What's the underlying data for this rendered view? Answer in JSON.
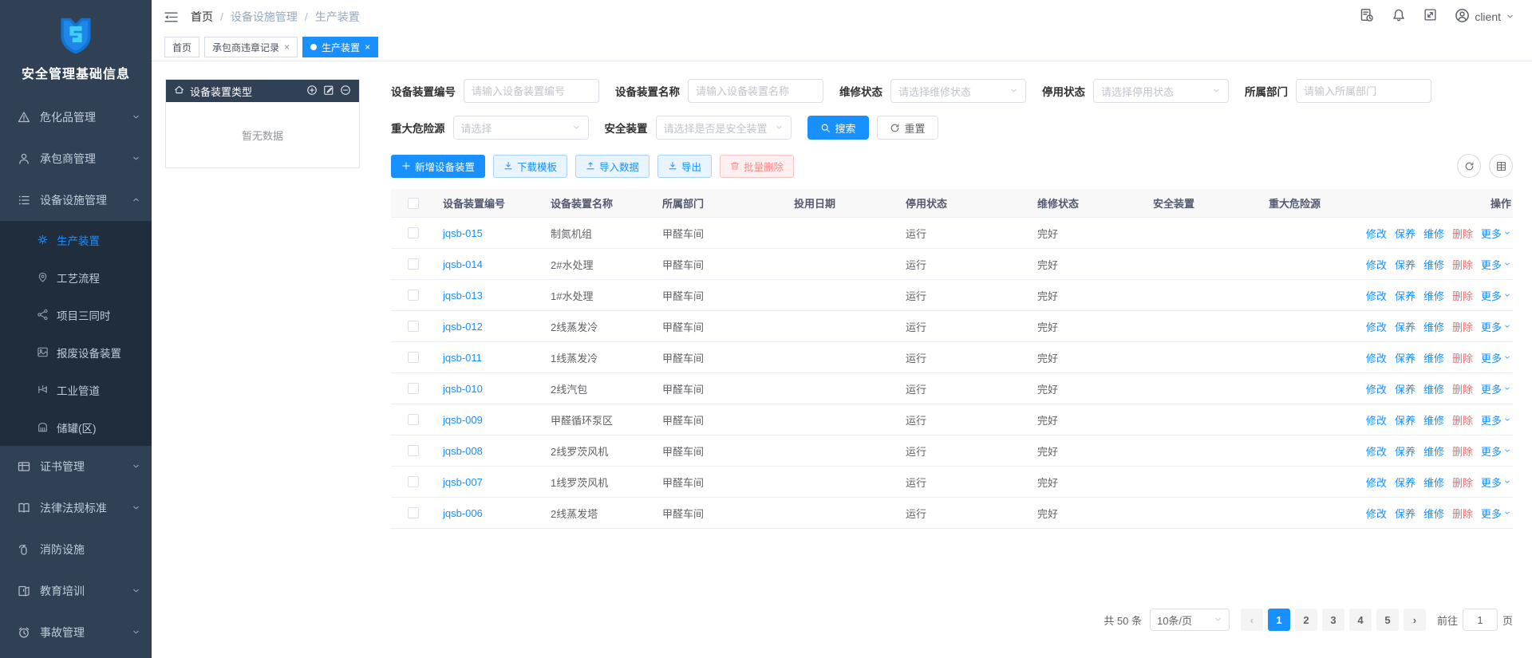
{
  "colors": {
    "accent": "#1890ff",
    "link": "#1890ff",
    "danger": "#f56c6c",
    "sidebar_bg": "#304156",
    "submenu_bg": "#1f2d3d"
  },
  "sidebar": {
    "title": "安全管理基础信息",
    "menu": [
      {
        "key": "hazmat",
        "icon": "hazard",
        "label": "危化品管理",
        "chevron": "down"
      },
      {
        "key": "contractor",
        "icon": "contractor",
        "label": "承包商管理",
        "chevron": "down"
      },
      {
        "key": "equipment",
        "icon": "equipment",
        "label": "设备设施管理",
        "chevron": "up",
        "children": [
          {
            "key": "production",
            "icon": "production",
            "label": "生产装置",
            "active": true
          },
          {
            "key": "process",
            "icon": "process",
            "label": "工艺流程"
          },
          {
            "key": "three-simultaneous",
            "icon": "three",
            "label": "项目三同时"
          },
          {
            "key": "scrap",
            "icon": "scrap",
            "label": "报废设备装置"
          },
          {
            "key": "pipeline",
            "icon": "pipeline",
            "label": "工业管道"
          },
          {
            "key": "tank",
            "icon": "tank",
            "label": "储罐(区)"
          }
        ]
      },
      {
        "key": "certificate",
        "icon": "cert",
        "label": "证书管理",
        "chevron": "down"
      },
      {
        "key": "law",
        "icon": "law",
        "label": "法律法规标准",
        "chevron": "down"
      },
      {
        "key": "fire",
        "icon": "fire",
        "label": "消防设施"
      },
      {
        "key": "education",
        "icon": "education",
        "label": "教育培训",
        "chevron": "down"
      },
      {
        "key": "accident",
        "icon": "accident",
        "label": "事故管理",
        "chevron": "down"
      }
    ]
  },
  "navbar": {
    "breadcrumb": [
      "首页",
      "设备设施管理",
      "生产装置"
    ],
    "user": "client"
  },
  "tabs": [
    {
      "label": "首页",
      "closable": false,
      "active": false
    },
    {
      "label": "承包商违章记录",
      "closable": true,
      "active": false
    },
    {
      "label": "生产装置",
      "closable": true,
      "active": true
    }
  ],
  "tree_panel": {
    "title": "设备装置类型",
    "empty_text": "暂无数据"
  },
  "filters": {
    "rows": [
      [
        {
          "key": "eq-code",
          "label": "设备装置编号",
          "type": "input",
          "placeholder": "请输入设备装置编号"
        },
        {
          "key": "eq-name",
          "label": "设备装置名称",
          "type": "input",
          "placeholder": "请输入设备装置名称"
        },
        {
          "key": "repair-status",
          "label": "维修状态",
          "type": "select",
          "placeholder": "请选择维修状态"
        },
        {
          "key": "stop-status",
          "label": "停用状态",
          "type": "select",
          "placeholder": "请选择停用状态"
        },
        {
          "key": "dept",
          "label": "所属部门",
          "type": "input",
          "placeholder": "请输入所属部门"
        }
      ],
      [
        {
          "key": "hazard",
          "label": "重大危险源",
          "type": "select",
          "placeholder": "请选择"
        },
        {
          "key": "safety",
          "label": "安全装置",
          "type": "select",
          "placeholder": "请选择是否是安全装置"
        }
      ]
    ],
    "search_label": "搜索",
    "reset_label": "重置"
  },
  "toolbar": {
    "buttons": [
      {
        "key": "add",
        "label": "新增设备装置",
        "icon": "plus",
        "style": "primary"
      },
      {
        "key": "download-template",
        "label": "下载模板",
        "icon": "download",
        "style": "primary-plain"
      },
      {
        "key": "import-data",
        "label": "导入数据",
        "icon": "upload",
        "style": "primary-plain"
      },
      {
        "key": "export",
        "label": "导出",
        "icon": "download",
        "style": "primary-plain"
      },
      {
        "key": "batch-delete",
        "label": "批量删除",
        "icon": "trash",
        "style": "danger-plain"
      }
    ]
  },
  "table": {
    "columns": [
      "设备装置编号",
      "设备装置名称",
      "所属部门",
      "投用日期",
      "停用状态",
      "维修状态",
      "安全装置",
      "重大危险源",
      "操作"
    ],
    "rows": [
      {
        "code": "jqsb-015",
        "name": "制氮机组",
        "dept": "甲醛车间",
        "date": "",
        "stop_status": "运行",
        "repair_status": "完好",
        "safety": "",
        "hazard": ""
      },
      {
        "code": "jqsb-014",
        "name": "2#水处理",
        "dept": "甲醛车间",
        "date": "",
        "stop_status": "运行",
        "repair_status": "完好",
        "safety": "",
        "hazard": ""
      },
      {
        "code": "jqsb-013",
        "name": "1#水处理",
        "dept": "甲醛车间",
        "date": "",
        "stop_status": "运行",
        "repair_status": "完好",
        "safety": "",
        "hazard": ""
      },
      {
        "code": "jqsb-012",
        "name": "2线蒸发冷",
        "dept": "甲醛车间",
        "date": "",
        "stop_status": "运行",
        "repair_status": "完好",
        "safety": "",
        "hazard": ""
      },
      {
        "code": "jqsb-011",
        "name": "1线蒸发冷",
        "dept": "甲醛车间",
        "date": "",
        "stop_status": "运行",
        "repair_status": "完好",
        "safety": "",
        "hazard": ""
      },
      {
        "code": "jqsb-010",
        "name": "2线汽包",
        "dept": "甲醛车间",
        "date": "",
        "stop_status": "运行",
        "repair_status": "完好",
        "safety": "",
        "hazard": ""
      },
      {
        "code": "jqsb-009",
        "name": "甲醛循环泵区",
        "dept": "甲醛车间",
        "date": "",
        "stop_status": "运行",
        "repair_status": "完好",
        "safety": "",
        "hazard": ""
      },
      {
        "code": "jqsb-008",
        "name": "2线罗茨风机",
        "dept": "甲醛车间",
        "date": "",
        "stop_status": "运行",
        "repair_status": "完好",
        "safety": "",
        "hazard": ""
      },
      {
        "code": "jqsb-007",
        "name": "1线罗茨风机",
        "dept": "甲醛车间",
        "date": "",
        "stop_status": "运行",
        "repair_status": "完好",
        "safety": "",
        "hazard": ""
      },
      {
        "code": "jqsb-006",
        "name": "2线蒸发塔",
        "dept": "甲醛车间",
        "date": "",
        "stop_status": "运行",
        "repair_status": "完好",
        "safety": "",
        "hazard": ""
      }
    ]
  },
  "row_actions": [
    {
      "key": "edit",
      "label": "修改"
    },
    {
      "key": "maintain",
      "label": "保养"
    },
    {
      "key": "repair",
      "label": "维修"
    },
    {
      "key": "delete",
      "label": "删除",
      "danger": true
    },
    {
      "key": "more",
      "label": "更多",
      "caret": true
    }
  ],
  "pagination": {
    "total": "共 50 条",
    "page_size": "10条/页",
    "pages": [
      "1",
      "2",
      "3",
      "4",
      "5"
    ],
    "active_page": "1",
    "goto_label": "前往",
    "goto_value": "1",
    "unit_label": "页"
  }
}
